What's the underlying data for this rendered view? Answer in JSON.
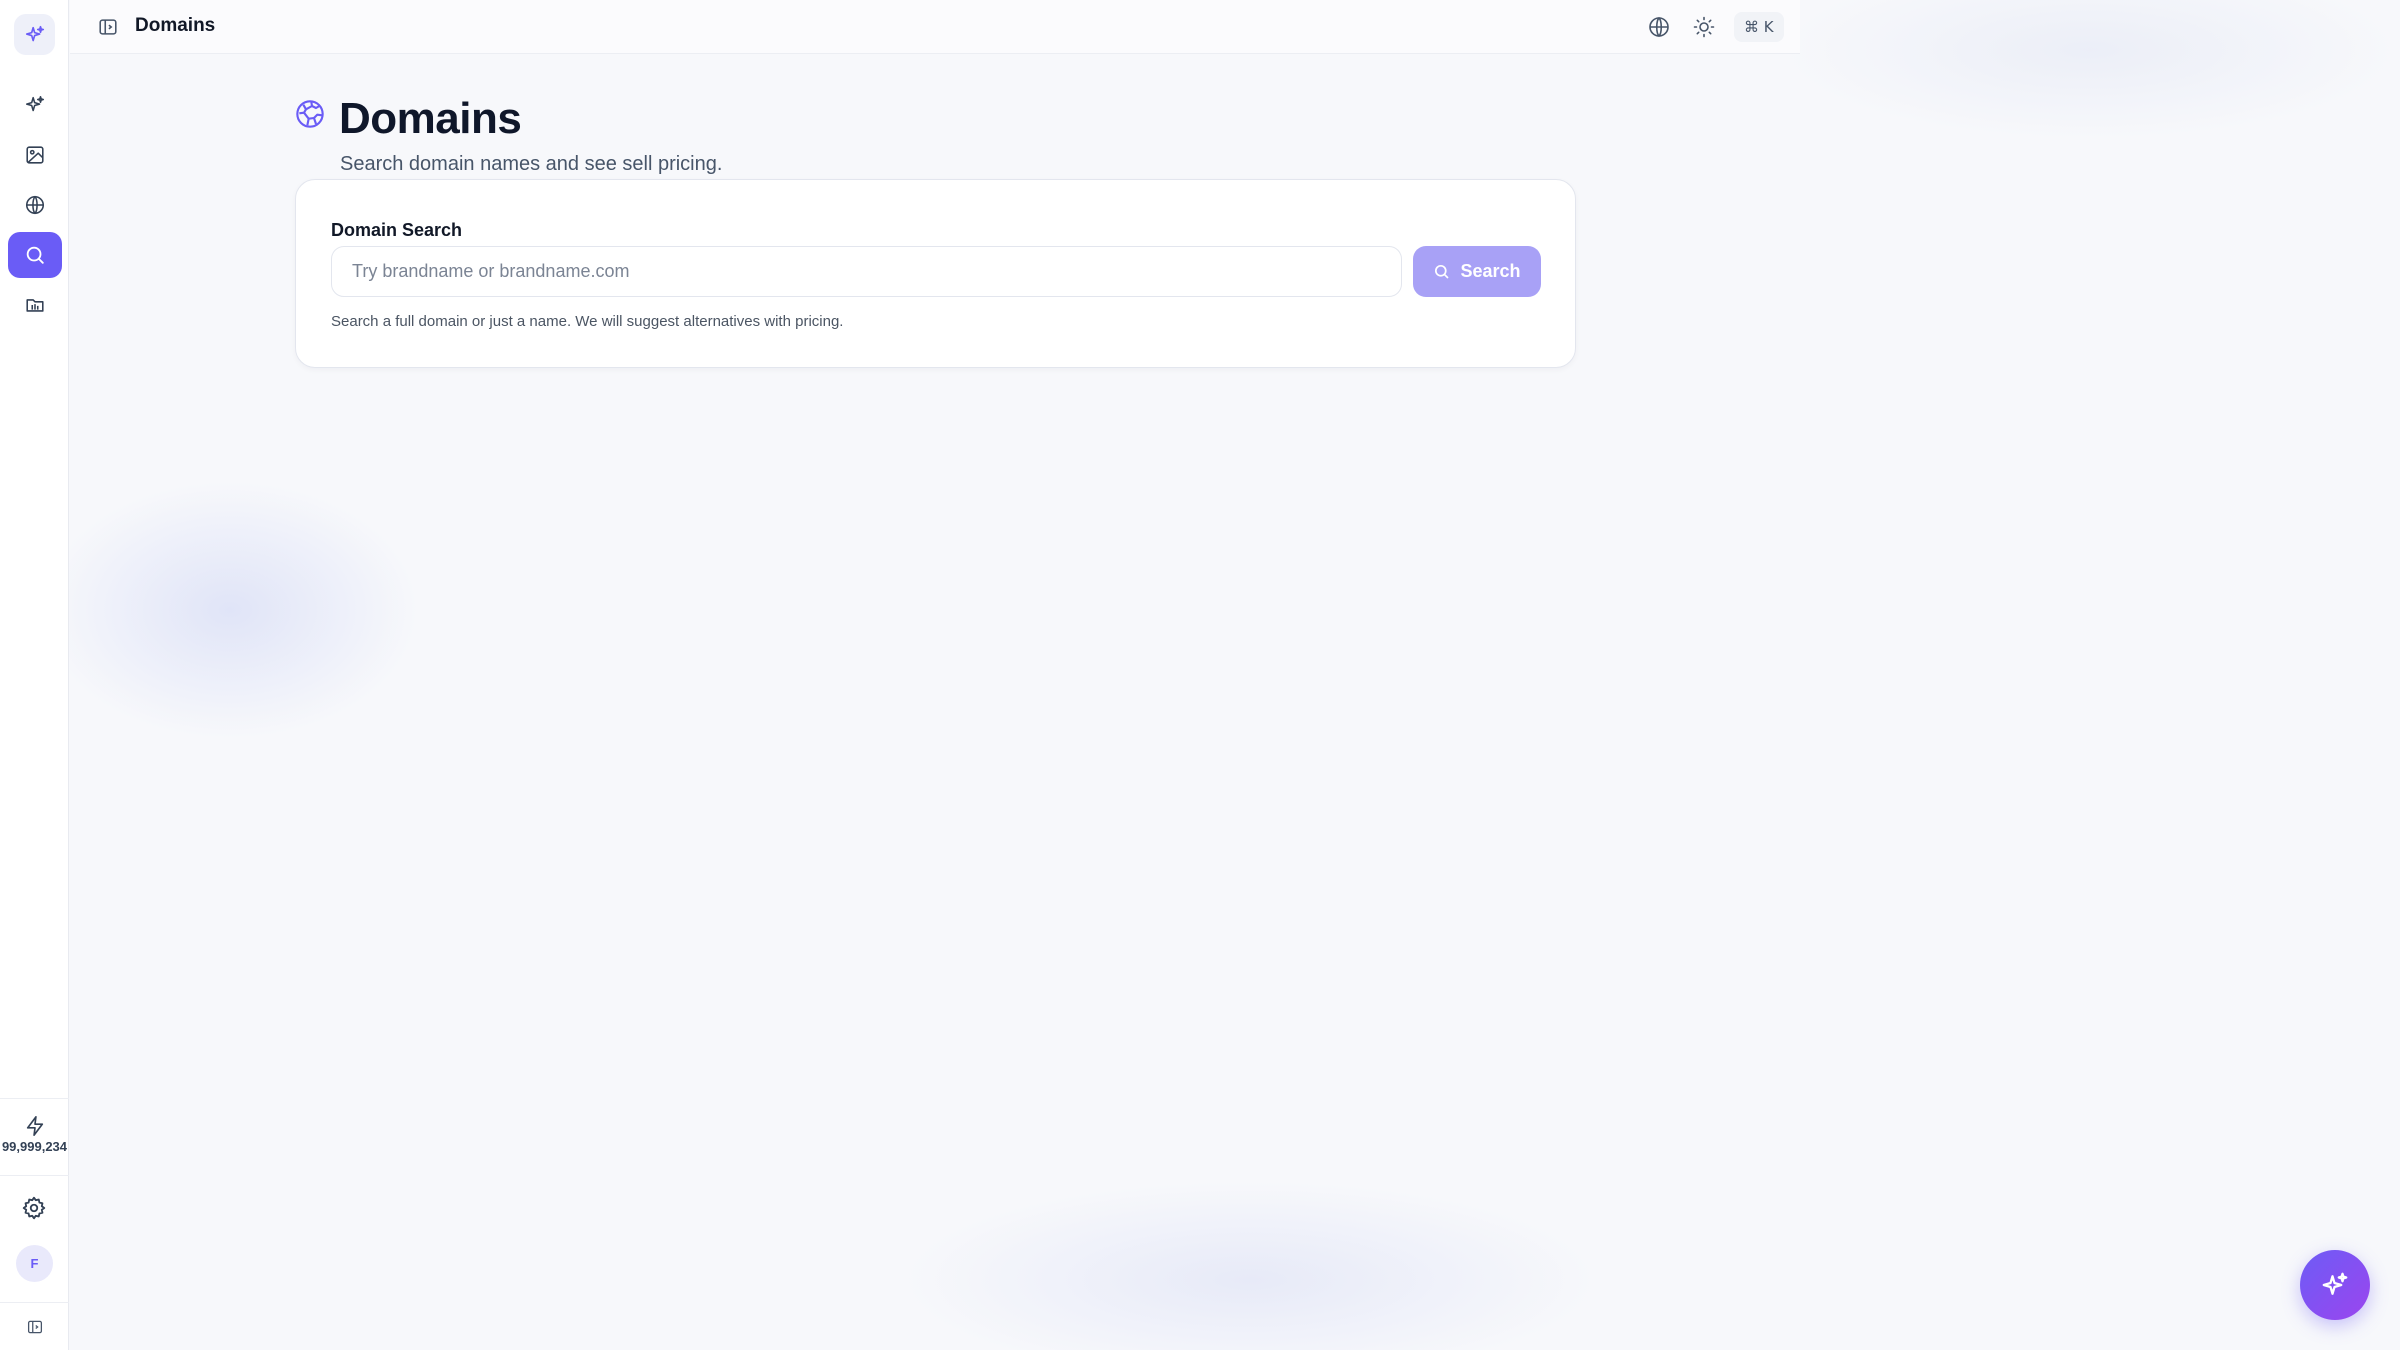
{
  "topbar": {
    "title": "Domains",
    "shortcut": "⌘ K"
  },
  "sidebar": {
    "items": [
      {
        "name": "ai-sparkles",
        "icon": "sparkles-icon"
      },
      {
        "name": "images",
        "icon": "image-icon"
      },
      {
        "name": "globe",
        "icon": "globe-icon"
      },
      {
        "name": "domain-search",
        "icon": "search-icon",
        "active": true
      },
      {
        "name": "folders",
        "icon": "folder-icon"
      }
    ],
    "credits": "99,999,234",
    "avatar_initial": "F"
  },
  "page": {
    "title": "Domains",
    "subtitle": "Search domain names and see sell pricing."
  },
  "search": {
    "label": "Domain Search",
    "placeholder": "Try brandname or brandname.com",
    "value": "",
    "button_label": "Search",
    "helper": "Search a full domain or just a name. We will suggest alternatives with pricing."
  },
  "colors": {
    "accent": "#6a5cf6",
    "button_disabled": "#a8a1f6",
    "fab_gradient_start": "#6d5cf6",
    "fab_gradient_end": "#9b45ee"
  }
}
